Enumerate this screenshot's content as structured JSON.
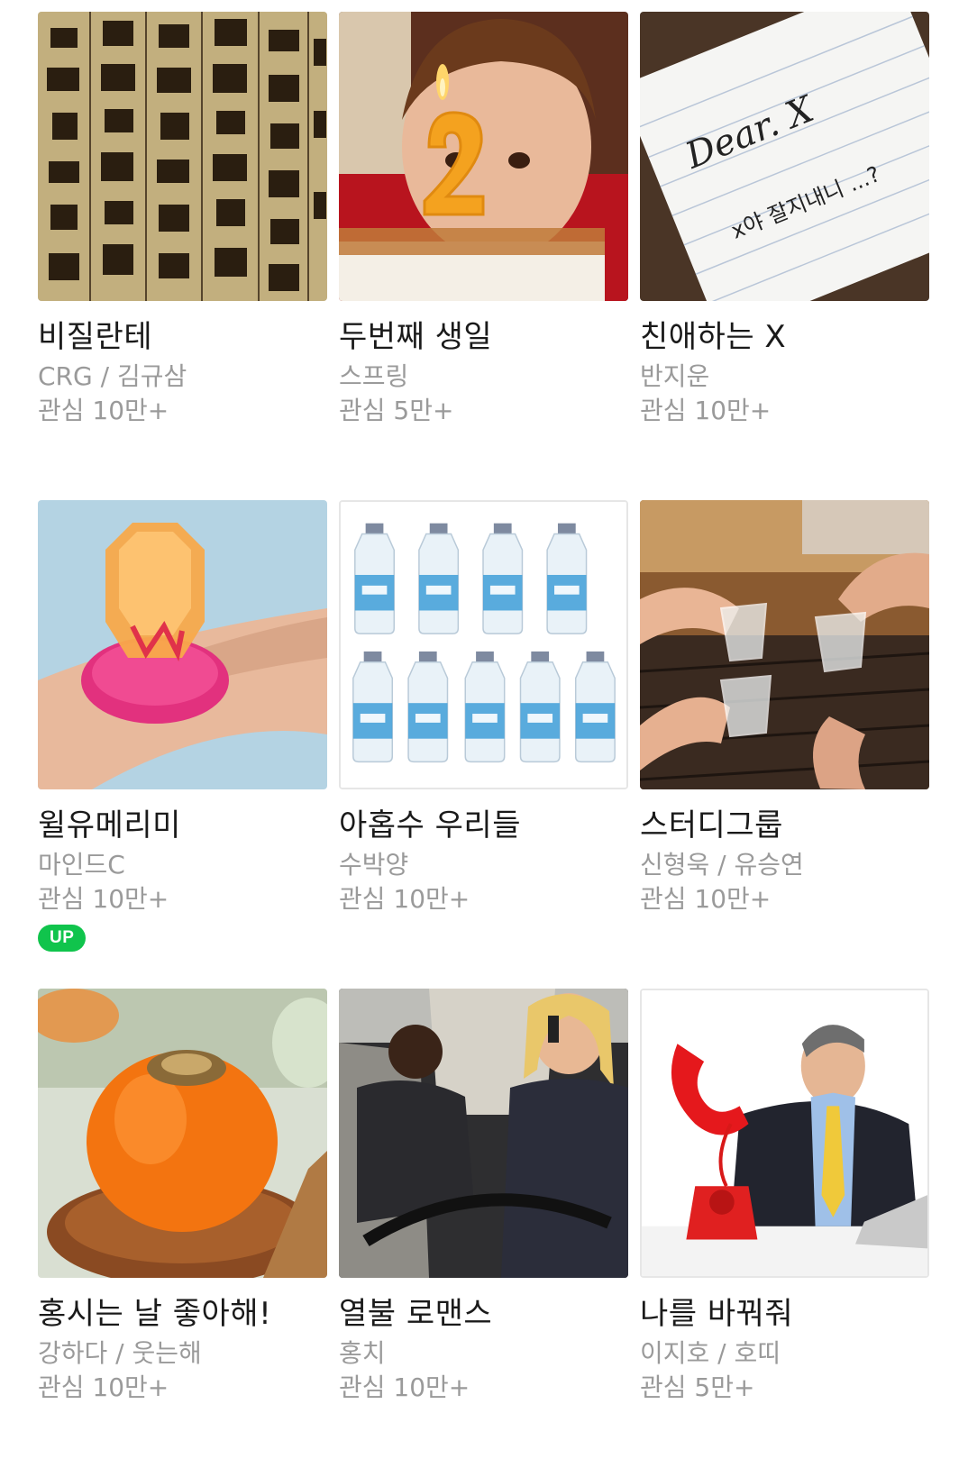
{
  "comics": [
    {
      "title": "비질란테",
      "author": "CRG / 김규삼",
      "interest": "관심 10만+",
      "thumb": "hanja-manuscript-image"
    },
    {
      "title": "두번째 생일",
      "author": "스프링",
      "interest": "관심 5만+",
      "thumb": "boy-birthday-cake-image"
    },
    {
      "title": "친애하는 X",
      "author": "반지운",
      "interest": "관심 10만+",
      "thumb": "dear-x-note-image",
      "note_line1": "Dear. X",
      "note_line2": "x야 잘지내니 ...?"
    },
    {
      "title": "윌유메리미",
      "author": "마인드C",
      "interest": "관심 10만+",
      "thumb": "candy-ring-image",
      "badge": "UP"
    },
    {
      "title": "아홉수 우리들",
      "author": "수박양",
      "interest": "관심 10만+",
      "thumb": "water-bottles-image"
    },
    {
      "title": "스터디그룹",
      "author": "신형욱 / 유승연",
      "interest": "관심 10만+",
      "thumb": "soju-toast-image"
    },
    {
      "title": "홍시는 날 좋아해!",
      "author": "강하다 / 웃는해",
      "interest": "관심 10만+",
      "thumb": "persimmon-image"
    },
    {
      "title": "열불 로맨스",
      "author": "홍치",
      "interest": "관심 10만+",
      "thumb": "car-couple-image"
    },
    {
      "title": "나를 바꿔줘",
      "author": "이지호 / 호띠",
      "interest": "관심 5만+",
      "thumb": "red-telephone-image"
    }
  ],
  "colors": {
    "title": "#1a1a1a",
    "meta": "#9a9a9a",
    "badge": "#10c44c"
  }
}
